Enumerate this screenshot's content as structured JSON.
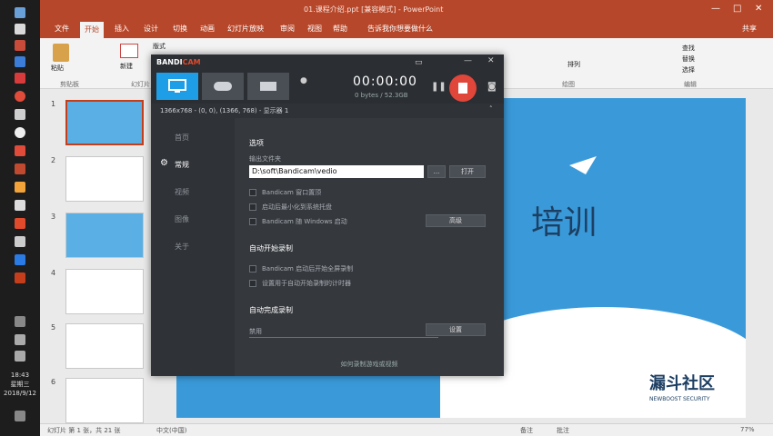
{
  "window_title": "01.课程介绍.ppt [兼容模式] - PowerPoint",
  "window_controls": [
    "—",
    "□",
    "✕"
  ],
  "tabs": [
    "文件",
    "开始",
    "插入",
    "设计",
    "切换",
    "动画",
    "幻灯片放映",
    "审阅",
    "视图",
    "帮助",
    "告诉我你想要做什么"
  ],
  "share": "共享",
  "ribbon_labels": {
    "clipboard": "剪贴板",
    "slides": "幻灯片",
    "paste": "粘贴",
    "new_slide": "新建",
    "layout": "版式",
    "editing": "编辑",
    "find": "查找",
    "replace": "替换",
    "select": "选择",
    "arrange": "排列",
    "sketch": "绘图"
  },
  "taskbar": {
    "time": "18:43",
    "weekday": "星期三",
    "date": "2018/9/12"
  },
  "slides": [
    "1",
    "2",
    "3",
    "4",
    "5",
    "6"
  ],
  "status": {
    "slide_info": "幻灯片 第 1 张，共 21 张",
    "lang": "中文(中国)",
    "notes": "备注",
    "comments": "批注",
    "zoom": "77%"
  },
  "canvas": {
    "title_fragment": "培训",
    "watermark_brand": "漏斗社区",
    "watermark_sub": "NEWBOOST SECURITY"
  },
  "bandicam": {
    "logo_a": "BANDI",
    "logo_b": "CAM",
    "timer": "00:00:00",
    "size": "0 bytes / 52.3GB",
    "resolution": "1366x768 - (0, 0), (1366, 768) - 显示器 1",
    "nav": [
      "首页",
      "常规",
      "视频",
      "图像",
      "关于"
    ],
    "active_nav": "常规",
    "section_options": "选项",
    "output_label": "输出文件夹",
    "output_path": "D:\\soft\\Bandicam\\vedio",
    "browse_btn": "...",
    "open_btn": "打开",
    "opt1": "Bandicam 窗口置顶",
    "opt2": "启动后最小化到系统托盘",
    "opt3": "Bandicam 随 Windows 启动",
    "advanced_btn": "高级",
    "section_autostart": "自动开始录制",
    "opt4": "Bandicam 启动后开始全屏录制",
    "opt5": "设置用于自动开始录制的计时器",
    "section_autocomplete": "自动完成录制",
    "disabled": "禁用",
    "settings_btn": "设置",
    "footer": "如何录制游戏或视频"
  }
}
